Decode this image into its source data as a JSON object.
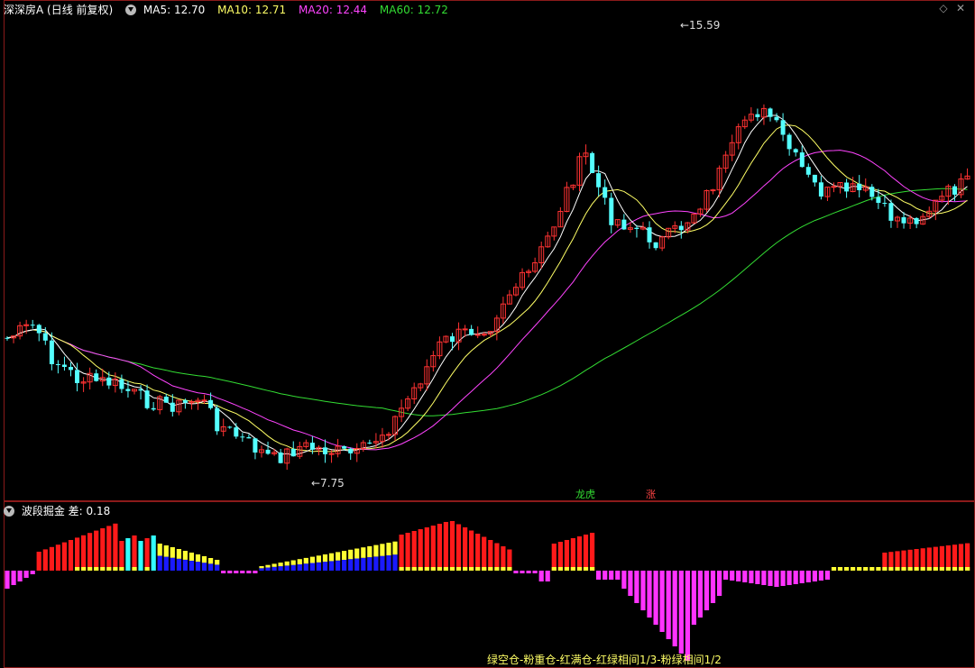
{
  "stock": {
    "name": "深深房A",
    "period": "(日线 前复权)"
  },
  "ma_legend": [
    {
      "label": "MA5: 12.70",
      "color": "#ffffff"
    },
    {
      "label": "MA10: 12.71",
      "color": "#ffff66"
    },
    {
      "label": "MA20: 12.44",
      "color": "#ff44ff"
    },
    {
      "label": "MA60: 12.72",
      "color": "#33dd33"
    }
  ],
  "high_label": "15.59",
  "low_label": "7.75",
  "event_labels": [
    {
      "text": "龙虎",
      "color": "#33dd33"
    },
    {
      "text": "涨",
      "color": "#ff4444"
    }
  ],
  "indicator": {
    "name": "波段掘金",
    "value_text": "差: 0.18",
    "legend": "绿空仓-粉重仓-红满仓-红绿相间1/3-粉绿相间1/2"
  },
  "colors": {
    "up": "#ff3232",
    "down": "#54ffff",
    "ma5": "#ffffff",
    "ma10": "#ffff66",
    "ma20": "#ff44ff",
    "ma60": "#33dd33",
    "red": "#ff1a1a",
    "yellow": "#ffff33",
    "blue": "#1a1aff",
    "cyan": "#33ffff",
    "magenta": "#ff33ff"
  },
  "chart_data": {
    "type": "candlestick",
    "series": [
      {
        "name": "MA5",
        "value": 12.7
      },
      {
        "name": "MA10",
        "value": 12.71
      },
      {
        "name": "MA20",
        "value": 12.44
      },
      {
        "name": "MA60",
        "value": 12.72
      }
    ],
    "period_high": 15.59,
    "period_low": 7.75
  }
}
